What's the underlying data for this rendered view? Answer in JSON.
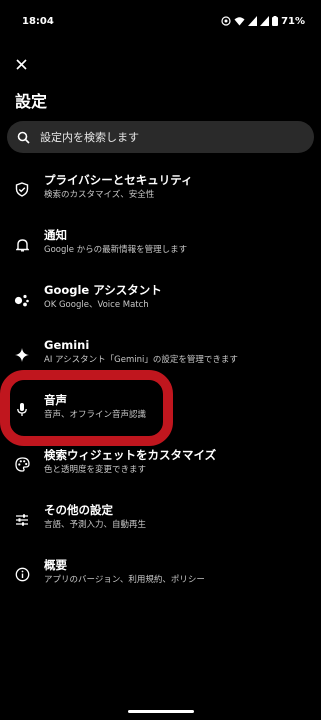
{
  "status_bar": {
    "time": "18:04",
    "battery": "71%"
  },
  "page": {
    "title": "設定"
  },
  "search": {
    "placeholder": "設定内を検索します"
  },
  "items": [
    {
      "title": "プライバシーとセキュリティ",
      "subtitle": "検索のカスタマイズ、安全性",
      "icon": "shield-icon"
    },
    {
      "title": "通知",
      "subtitle": "Google からの最新情報を管理します",
      "icon": "bell-icon"
    },
    {
      "title": "Google アシスタント",
      "subtitle": "OK Google、Voice Match",
      "icon": "assistant-icon"
    },
    {
      "title": "Gemini",
      "subtitle": "AI アシスタント「Gemini」の設定を管理できます",
      "icon": "sparkle-icon"
    },
    {
      "title": "音声",
      "subtitle": "音声、オフライン音声認識",
      "icon": "microphone-icon"
    },
    {
      "title": "検索ウィジェットをカスタマイズ",
      "subtitle": "色と透明度を変更できます",
      "icon": "palette-icon"
    },
    {
      "title": "その他の設定",
      "subtitle": "言語、予測入力、自動再生",
      "icon": "sliders-icon"
    },
    {
      "title": "概要",
      "subtitle": "アプリのバージョン、利用規約、ポリシー",
      "icon": "info-icon"
    }
  ],
  "colors": {
    "background": "#000000",
    "search_bg": "#2a2a2a",
    "highlight": "#c0161e"
  }
}
